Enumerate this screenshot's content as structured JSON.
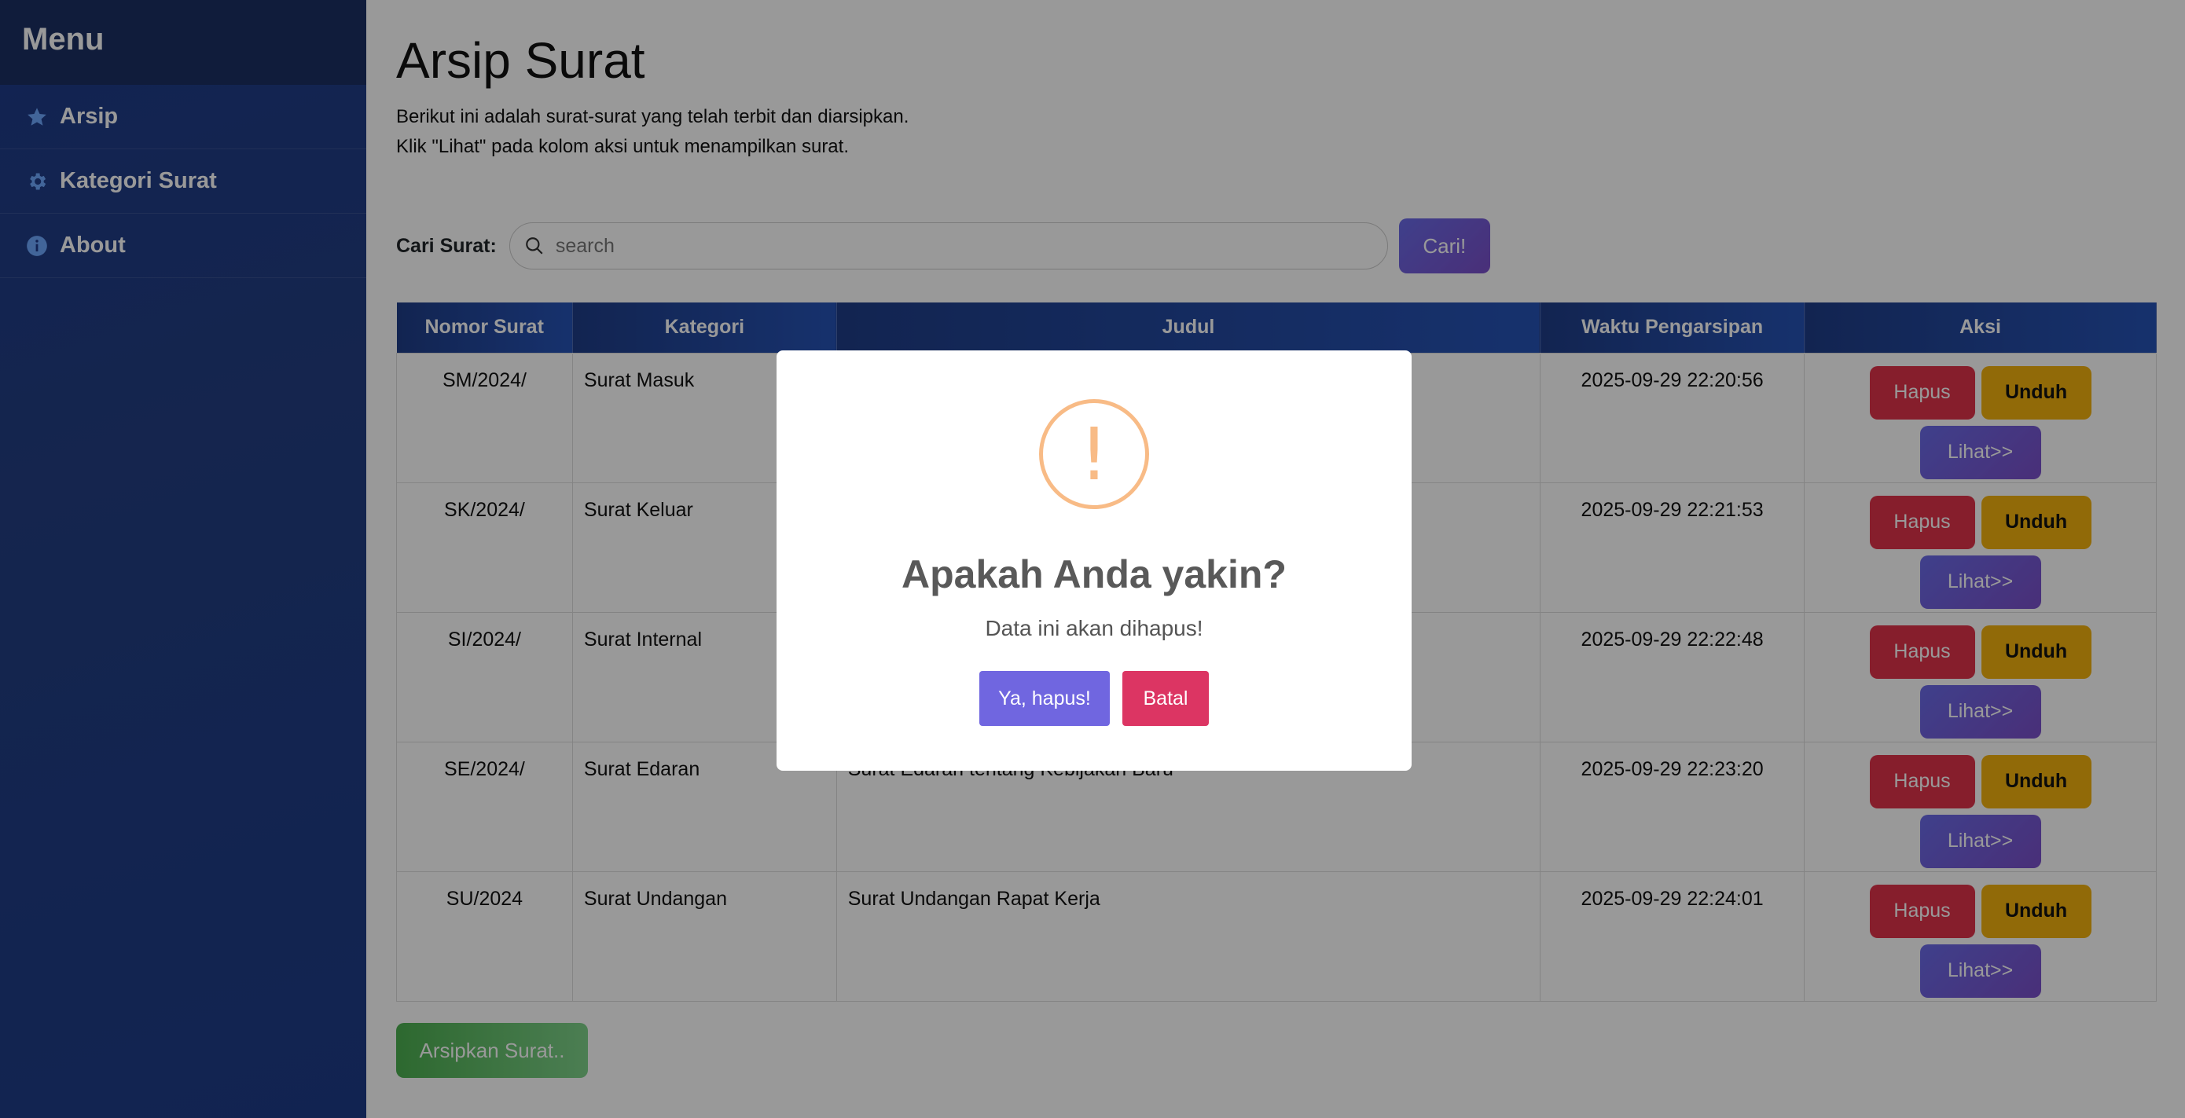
{
  "sidebar": {
    "title": "Menu",
    "items": [
      {
        "label": "Arsip",
        "icon": "star-icon"
      },
      {
        "label": "Kategori Surat",
        "icon": "gear-icon"
      },
      {
        "label": "About",
        "icon": "info-icon"
      }
    ]
  },
  "page": {
    "title": "Arsip Surat",
    "desc_line1": "Berikut ini adalah surat-surat yang telah terbit dan diarsipkan.",
    "desc_line2": "Klik \"Lihat\" pada kolom aksi untuk menampilkan surat."
  },
  "search": {
    "label": "Cari Surat:",
    "placeholder": "search",
    "button": "Cari!"
  },
  "table": {
    "headers": [
      "Nomor Surat",
      "Kategori",
      "Judul",
      "Waktu Pengarsipan",
      "Aksi"
    ],
    "rows": [
      {
        "nomor": "SM/2024/",
        "kategori": "Surat Masuk",
        "judul": "",
        "waktu": "2025-09-29 22:20:56"
      },
      {
        "nomor": "SK/2024/",
        "kategori": "Surat Keluar",
        "judul": "",
        "waktu": "2025-09-29 22:21:53"
      },
      {
        "nomor": "SI/2024/",
        "kategori": "Surat Internal",
        "judul": "",
        "waktu": "2025-09-29 22:22:48"
      },
      {
        "nomor": "SE/2024/",
        "kategori": "Surat Edaran",
        "judul": "Surat Edaran tentang Kebijakan Baru",
        "waktu": "2025-09-29 22:23:20"
      },
      {
        "nomor": "SU/2024",
        "kategori": "Surat Undangan",
        "judul": "Surat Undangan Rapat Kerja",
        "waktu": "2025-09-29 22:24:01"
      }
    ],
    "actions": {
      "hapus": "Hapus",
      "unduh": "Unduh",
      "lihat": "Lihat>>"
    }
  },
  "archive_button": "Arsipkan Surat..",
  "modal": {
    "icon": "warning-icon",
    "icon_glyph": "!",
    "title": "Apakah Anda yakin?",
    "text": "Data ini akan dihapus!",
    "confirm": "Ya, hapus!",
    "cancel": "Batal"
  },
  "colors": {
    "sidebar": "#1e3a8a",
    "hapus": "#e0334a",
    "unduh": "#f2b10e",
    "lihat": "#6a6be8",
    "confirm": "#7066e0",
    "cancel": "#dc3563",
    "warning": "#f8bb86"
  }
}
